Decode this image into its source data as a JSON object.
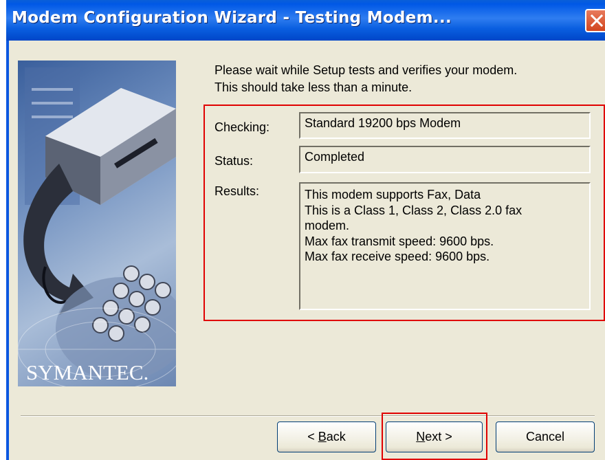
{
  "window": {
    "title": "Modem Configuration Wizard - Testing Modem..."
  },
  "graphic": {
    "logo_text": "SYMANTEC."
  },
  "intro": {
    "line1": "Please wait while Setup tests and verifies your modem.",
    "line2": "This should take less than a minute."
  },
  "fields": {
    "checking_label": "Checking:",
    "checking_value": "Standard 19200 bps Modem",
    "status_label": "Status:",
    "status_value": "Completed",
    "results_label": "Results:",
    "results_lines": [
      "This modem supports Fax, Data",
      "This is a Class 1, Class 2, Class 2.0 fax",
      "modem.",
      "Max fax transmit speed:  9600 bps.",
      "Max fax receive speed:  9600 bps."
    ]
  },
  "buttons": {
    "back_mnemonic": "B",
    "back_rest": "ack",
    "back_prefix": "< ",
    "next_mnemonic": "N",
    "next_rest": "ext >",
    "cancel": "Cancel"
  },
  "colors": {
    "titlebar": "#0058e6",
    "highlight": "#e00000",
    "dialog_bg": "#ece9d8"
  }
}
